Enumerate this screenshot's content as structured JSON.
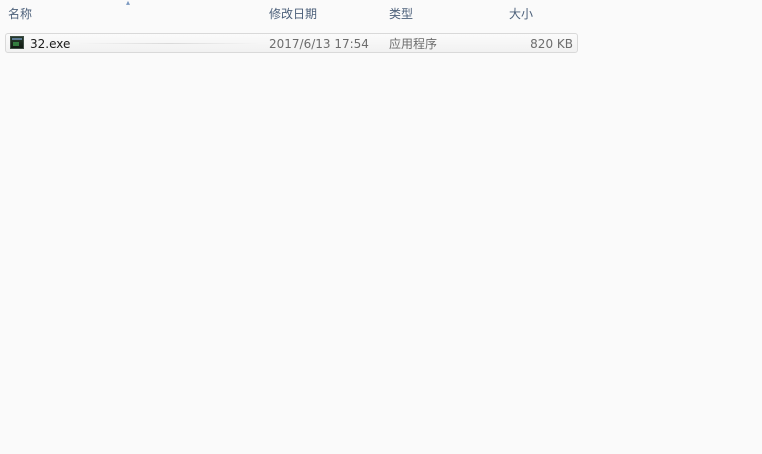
{
  "columns": {
    "name": "名称",
    "date_modified": "修改日期",
    "type": "类型",
    "size": "大小"
  },
  "files": [
    {
      "icon": "exe-app-icon",
      "name": "32.exe",
      "date_modified": "2017/6/13 17:54",
      "type": "应用程序",
      "size": "820 KB"
    }
  ],
  "colors": {
    "header_text": "#4c607a",
    "row_border": "#d9d9d9",
    "background": "#fafafa"
  }
}
